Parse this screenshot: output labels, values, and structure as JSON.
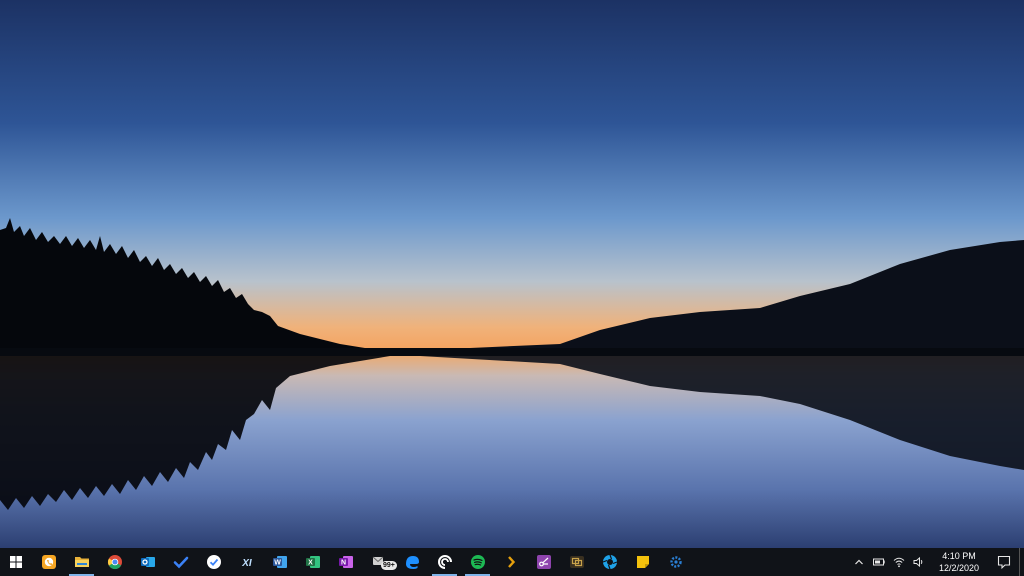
{
  "desktop": {
    "wallpaper": "lake-sunset-silhouette",
    "colors": {
      "sky_top": "#1c3264",
      "sky_mid": "#5a8ac4",
      "horizon": "#f3b070",
      "water": "#6f8cc4"
    }
  },
  "taskbar": {
    "start_icon": "windows-logo-icon",
    "apps": [
      {
        "name": "phone-app",
        "icon": "phone-icon",
        "color": "#f6a623"
      },
      {
        "name": "file-explorer",
        "icon": "folder-icon",
        "color": "#f5c542",
        "running": true
      },
      {
        "name": "chrome",
        "icon": "chrome-icon",
        "color": "#dd4b39"
      },
      {
        "name": "outlook",
        "icon": "outlook-icon",
        "color": "#0f6cbd"
      },
      {
        "name": "microsoft-todo",
        "icon": "checkmark-icon",
        "color": "#3b82f6"
      },
      {
        "name": "tick-app",
        "icon": "check-circle-icon",
        "color": "#ffffff"
      },
      {
        "name": "xi-app",
        "icon": "xi-icon",
        "color": "#4aa3ff",
        "label": "XI"
      },
      {
        "name": "word",
        "icon": "word-icon",
        "color": "#2b579a",
        "label": "W"
      },
      {
        "name": "excel",
        "icon": "excel-icon",
        "color": "#217346",
        "label": "X"
      },
      {
        "name": "onenote",
        "icon": "onenote-icon",
        "color": "#7719aa",
        "label": "N"
      },
      {
        "name": "mail",
        "icon": "mail-icon",
        "color": "#d0d0d0",
        "badge": "99+"
      },
      {
        "name": "edge",
        "icon": "edge-icon",
        "color": "#1e90ff"
      },
      {
        "name": "pocket-casts",
        "icon": "podcast-icon",
        "color": "#ffffff",
        "running": true
      },
      {
        "name": "spotify",
        "icon": "spotify-icon",
        "color": "#1db954",
        "running": true
      },
      {
        "name": "plex",
        "icon": "chevron-right-icon",
        "color": "#e5a00d"
      },
      {
        "name": "snip-sketch",
        "icon": "snip-icon",
        "color": "#8e44ad"
      },
      {
        "name": "screen-app",
        "icon": "screenshot-icon",
        "color": "#c8a24a"
      },
      {
        "name": "aperture-app",
        "icon": "aperture-icon",
        "color": "#1fa2e8"
      },
      {
        "name": "sticky-notes",
        "icon": "sticky-note-icon",
        "color": "#f4c20d"
      },
      {
        "name": "settings-app",
        "icon": "gear-icon",
        "color": "#2a7fd4"
      }
    ],
    "tray": {
      "time": "4:10 PM",
      "date": "12/2/2020"
    }
  }
}
